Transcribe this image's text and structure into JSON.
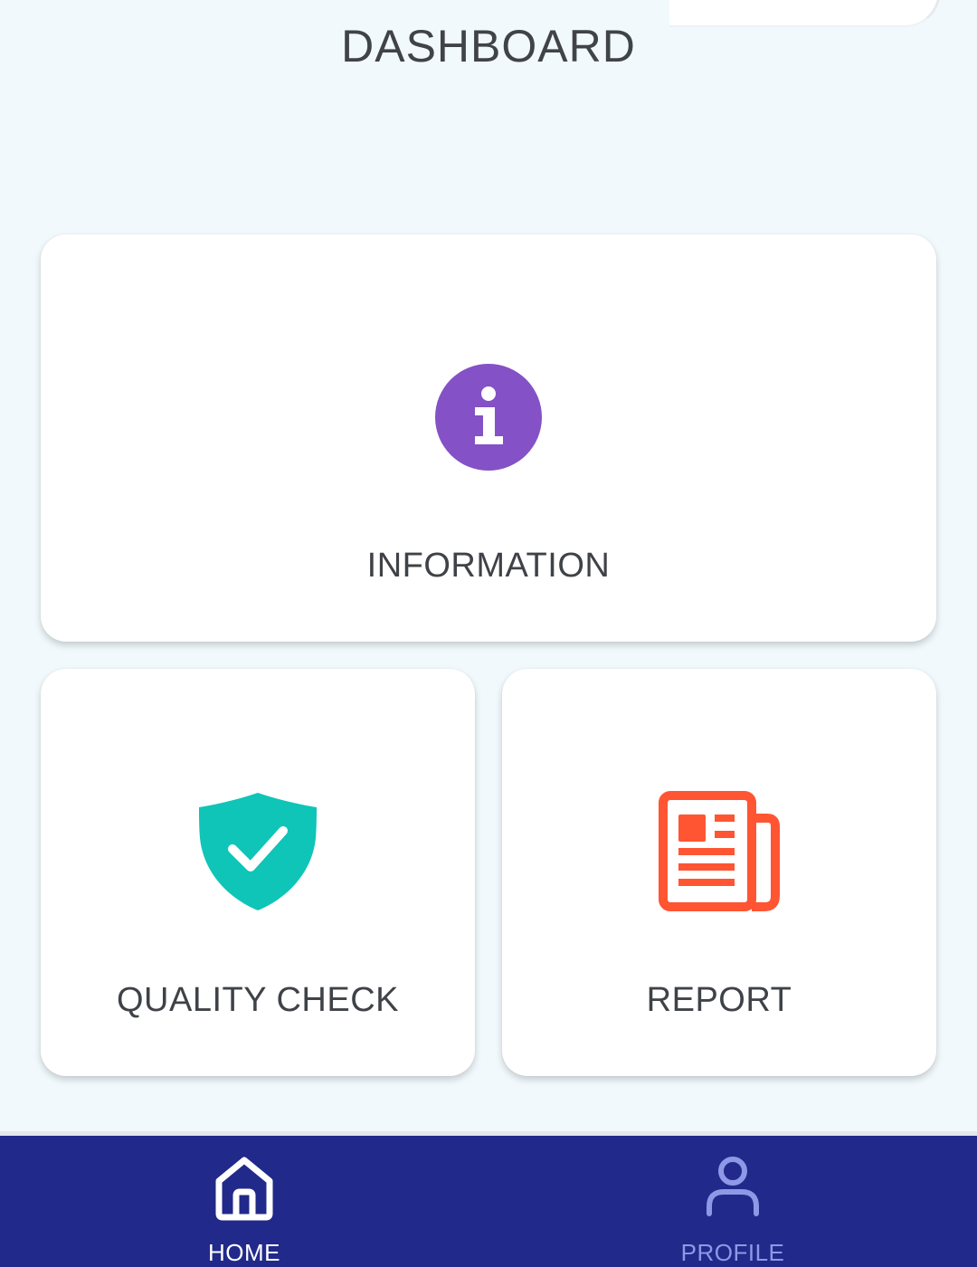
{
  "header": {
    "title": "DASHBOARD"
  },
  "cards": {
    "information": {
      "label": "INFORMATION",
      "icon": "info-icon",
      "color": "#8451c6"
    },
    "quality_check": {
      "label": "QUALITY CHECK",
      "icon": "shield-check-icon",
      "color": "#0ec5b8"
    },
    "report": {
      "label": "REPORT",
      "icon": "newspaper-icon",
      "color": "#ff5533"
    }
  },
  "bottom_nav": {
    "background": "#21298a",
    "items": [
      {
        "label": "HOME",
        "icon": "home-icon",
        "active": true
      },
      {
        "label": "PROFILE",
        "icon": "user-icon",
        "active": false
      }
    ]
  }
}
